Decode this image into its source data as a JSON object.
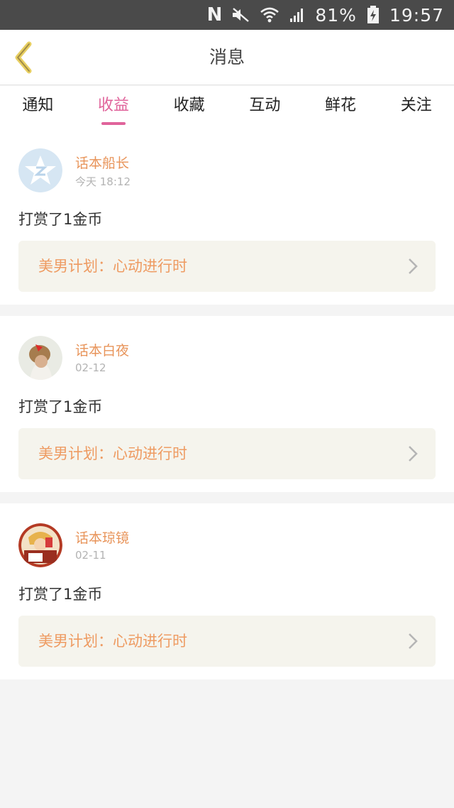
{
  "status_bar": {
    "carrier_icon": "N",
    "battery": "81%",
    "time": "19:57",
    "icons": [
      "n-icon",
      "mute-icon",
      "wifi-icon",
      "signal-icon",
      "battery-charging-icon"
    ]
  },
  "header": {
    "title": "消息",
    "back_icon": "chevron-left-icon"
  },
  "tabs": [
    {
      "label": "通知",
      "active": false
    },
    {
      "label": "收益",
      "active": true
    },
    {
      "label": "收藏",
      "active": false
    },
    {
      "label": "互动",
      "active": false
    },
    {
      "label": "鲜花",
      "active": false
    },
    {
      "label": "关注",
      "active": false
    }
  ],
  "messages": [
    {
      "user": "话本船长",
      "time": "今天 18:12",
      "action": "打赏了1金币",
      "link": "美男计划：心动进行时",
      "avatar": "z-star-avatar"
    },
    {
      "user": "话本白夜",
      "time": "02-12",
      "action": "打赏了1金币",
      "link": "美男计划：心动进行时",
      "avatar": "girl-avatar"
    },
    {
      "user": "话本琼镜",
      "time": "02-11",
      "action": "打赏了1金币",
      "link": "美男计划：心动进行时",
      "avatar": "cartoon-avatar"
    }
  ],
  "colors": {
    "accent_pink": "#e0649b",
    "username_orange": "#e8945a",
    "link_orange": "#ee9b62",
    "link_bg": "#f5f4ed",
    "back_arrow": "#e8cf62"
  }
}
